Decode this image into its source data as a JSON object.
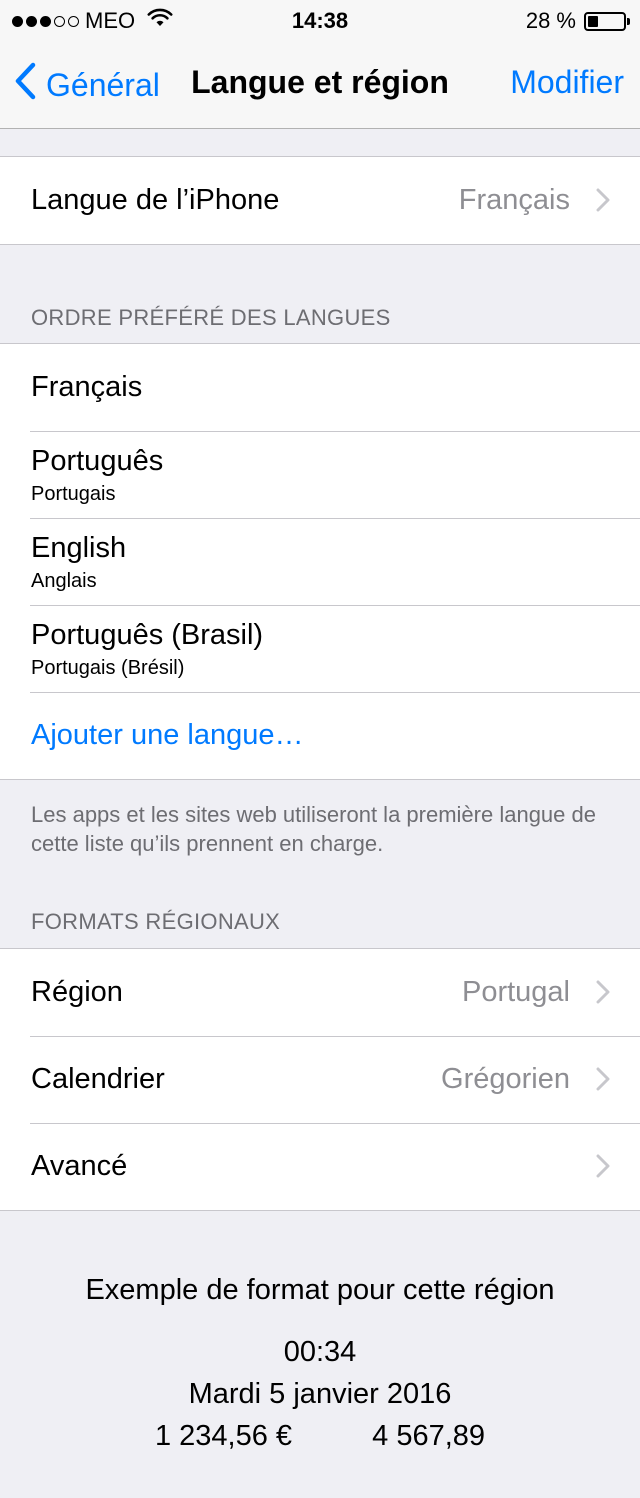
{
  "status": {
    "carrier": "MEO",
    "signal_full": 3,
    "signal_total": 5,
    "time": "14:38",
    "battery_text": "28 %",
    "battery_level": 0.28
  },
  "nav": {
    "back_label": "Général",
    "title": "Langue et région",
    "edit_label": "Modifier"
  },
  "iphone_language": {
    "label": "Langue de l’iPhone",
    "value": "Français"
  },
  "preferred": {
    "header": "ORDRE PRÉFÉRÉ DES LANGUES",
    "items": [
      {
        "name": "Français",
        "subtitle": ""
      },
      {
        "name": "Português",
        "subtitle": "Portugais"
      },
      {
        "name": "English",
        "subtitle": "Anglais"
      },
      {
        "name": "Português (Brasil)",
        "subtitle": "Portugais (Brésil)"
      }
    ],
    "add_label": "Ajouter une langue…",
    "footer": "Les apps et les sites web utiliseront la première langue de cette liste qu’ils prennent en charge."
  },
  "regional": {
    "header": "FORMATS RÉGIONAUX",
    "region_label": "Région",
    "region_value": "Portugal",
    "calendar_label": "Calendrier",
    "calendar_value": "Grégorien",
    "advanced_label": "Avancé"
  },
  "example": {
    "title": "Exemple de format pour cette région",
    "time": "00:34",
    "date": "Mardi 5 janvier 2016",
    "currency": "1 234,56 €",
    "number": "4 567,89"
  },
  "colors": {
    "accent": "#007aff",
    "background": "#efeff4",
    "secondary_text": "#8e8e93"
  }
}
